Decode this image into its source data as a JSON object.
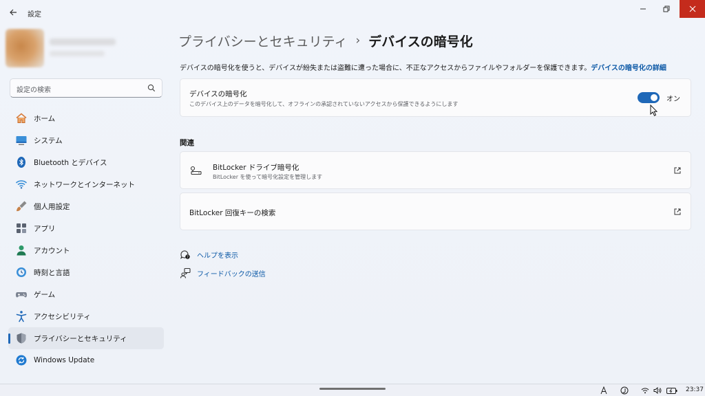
{
  "window": {
    "app_title": "設定",
    "back_icon": "back-arrow-icon",
    "controls": {
      "minimize": "minimize-icon",
      "maximize": "restore-icon",
      "close": "close-icon"
    }
  },
  "sidebar": {
    "search_placeholder": "設定の検索",
    "items": [
      {
        "label": "ホーム",
        "icon": "home-icon"
      },
      {
        "label": "システム",
        "icon": "system-icon"
      },
      {
        "label": "Bluetooth とデバイス",
        "icon": "bluetooth-icon"
      },
      {
        "label": "ネットワークとインターネット",
        "icon": "network-icon"
      },
      {
        "label": "個人用設定",
        "icon": "personalization-icon"
      },
      {
        "label": "アプリ",
        "icon": "apps-icon"
      },
      {
        "label": "アカウント",
        "icon": "account-icon"
      },
      {
        "label": "時刻と言語",
        "icon": "time-language-icon"
      },
      {
        "label": "ゲーム",
        "icon": "gaming-icon"
      },
      {
        "label": "アクセシビリティ",
        "icon": "accessibility-icon"
      },
      {
        "label": "プライバシーとセキュリティ",
        "icon": "privacy-shield-icon",
        "active": true
      },
      {
        "label": "Windows Update",
        "icon": "windows-update-icon"
      }
    ]
  },
  "main": {
    "breadcrumb": {
      "parent": "プライバシーとセキュリティ",
      "separator": "›",
      "current": "デバイスの暗号化"
    },
    "description": "デバイスの暗号化を使うと、デバイスが紛失または盗難に遭った場合に、不正なアクセスからファイルやフォルダーを保護できます。",
    "description_link": "デバイスの暗号化の詳細",
    "encryption_card": {
      "title": "デバイスの暗号化",
      "subtitle": "このデバイス上のデータを暗号化して、オフラインの承認されていないアクセスから保護できるようにします",
      "toggle_state": "オン",
      "toggle_on": true
    },
    "related_title": "関連",
    "related": [
      {
        "title": "BitLocker ドライブ暗号化",
        "subtitle": "BitLocker を使って暗号化設定を管理します",
        "icon": "bitlocker-key-icon"
      },
      {
        "title": "BitLocker 回復キーの検索"
      }
    ],
    "help_links": [
      {
        "label": "ヘルプを表示",
        "icon": "help-icon"
      },
      {
        "label": "フィードバックの送信",
        "icon": "feedback-icon"
      }
    ]
  },
  "taskbar": {
    "time": "23:37",
    "tray_icons": [
      "ime-a-icon",
      "ime-mode-icon",
      "wifi-icon",
      "volume-icon",
      "battery-icon"
    ]
  },
  "colors": {
    "accent": "#1f68b8",
    "link": "#0b58a6",
    "close": "#c42b1c"
  }
}
